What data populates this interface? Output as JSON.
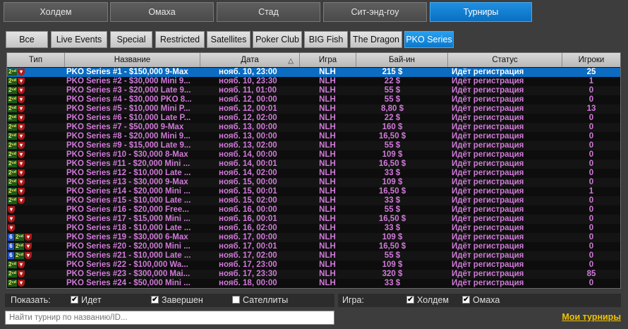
{
  "main_tabs": [
    "Холдем",
    "Омаха",
    "Стад",
    "Сит-энд-гоу",
    "Турниры"
  ],
  "main_tab_active": "Турниры",
  "sub_tabs": [
    "Все",
    "Live Events",
    "Special",
    "Restricted",
    "Satellites",
    "Poker Club",
    "BIG Fish",
    "The Dragon",
    "PKO Series"
  ],
  "sub_tab_active": "PKO Series",
  "columns": {
    "type": "Тип",
    "name": "Название",
    "date": "Дата",
    "game": "Игра",
    "buyin": "Бай-ин",
    "status": "Статус",
    "players": "Игроки"
  },
  "sort_indicator": "△",
  "rows": [
    {
      "icons": [
        "2nd",
        "shield"
      ],
      "name": "PKO Series #1 - $150,000 9-Max",
      "date": "нояб. 10, 23:00",
      "game": "NLH",
      "buyin": "215 $",
      "status": "Идёт регистрация",
      "players": "25",
      "selected": true
    },
    {
      "icons": [
        "2nd",
        "shield"
      ],
      "name": "PKO Series #2 - $30,000 Mini 9...",
      "date": "нояб. 10, 23:30",
      "game": "NLH",
      "buyin": "22 $",
      "status": "Идёт регистрация",
      "players": "1"
    },
    {
      "icons": [
        "2nd",
        "shield"
      ],
      "name": "PKO Series #3 - $20,000 Late 9...",
      "date": "нояб. 11, 01:00",
      "game": "NLH",
      "buyin": "55 $",
      "status": "Идёт регистрация",
      "players": "0"
    },
    {
      "icons": [
        "2nd",
        "shield"
      ],
      "name": "PKO Series #4 - $30,000 PKO 8...",
      "date": "нояб. 12, 00:00",
      "game": "NLH",
      "buyin": "55 $",
      "status": "Идёт регистрация",
      "players": "0"
    },
    {
      "icons": [
        "2nd",
        "shield"
      ],
      "name": "PKO Series #5 - $10,000 Mini P...",
      "date": "нояб. 12, 00:01",
      "game": "NLH",
      "buyin": "8,80 $",
      "status": "Идёт регистрация",
      "players": "13"
    },
    {
      "icons": [
        "2nd",
        "shield"
      ],
      "name": "PKO Series #6 - $10,000 Late P...",
      "date": "нояб. 12, 02:00",
      "game": "NLH",
      "buyin": "22 $",
      "status": "Идёт регистрация",
      "players": "0"
    },
    {
      "icons": [
        "2nd",
        "shield"
      ],
      "name": "PKO Series #7 - $50,000 9-Max",
      "date": "нояб. 13, 00:00",
      "game": "NLH",
      "buyin": "160 $",
      "status": "Идёт регистрация",
      "players": "0"
    },
    {
      "icons": [
        "2nd",
        "shield"
      ],
      "name": "PKO Series #8 - $20,000 Mini 9...",
      "date": "нояб. 13, 00:00",
      "game": "NLH",
      "buyin": "16,50 $",
      "status": "Идёт регистрация",
      "players": "0"
    },
    {
      "icons": [
        "2nd",
        "shield"
      ],
      "name": "PKO Series #9 - $15,000 Late 9...",
      "date": "нояб. 13, 02:00",
      "game": "NLH",
      "buyin": "55 $",
      "status": "Идёт регистрация",
      "players": "0"
    },
    {
      "icons": [
        "2nd",
        "shield"
      ],
      "name": "PKO Series #10 - $30,000 8-Max",
      "date": "нояб. 14, 00:00",
      "game": "NLH",
      "buyin": "109 $",
      "status": "Идёт регистрация",
      "players": "0"
    },
    {
      "icons": [
        "2nd",
        "shield"
      ],
      "name": "PKO Series #11 - $20,000 Mini ...",
      "date": "нояб. 14, 00:01",
      "game": "NLH",
      "buyin": "16,50 $",
      "status": "Идёт регистрация",
      "players": "0"
    },
    {
      "icons": [
        "2nd",
        "shield"
      ],
      "name": "PKO Series #12 - $10,000 Late ...",
      "date": "нояб. 14, 02:00",
      "game": "NLH",
      "buyin": "33 $",
      "status": "Идёт регистрация",
      "players": "0"
    },
    {
      "icons": [
        "2nd",
        "shield"
      ],
      "name": "PKO Series #13 - $30,000 9-Max",
      "date": "нояб. 15, 00:00",
      "game": "NLH",
      "buyin": "109 $",
      "status": "Идёт регистрация",
      "players": "0"
    },
    {
      "icons": [
        "2nd",
        "shield"
      ],
      "name": "PKO Series #14 - $20,000 Mini ...",
      "date": "нояб. 15, 00:01",
      "game": "NLH",
      "buyin": "16,50 $",
      "status": "Идёт регистрация",
      "players": "1"
    },
    {
      "icons": [
        "2nd",
        "shield"
      ],
      "name": "PKO Series #15 - $10,000 Late ...",
      "date": "нояб. 15, 02:00",
      "game": "NLH",
      "buyin": "33 $",
      "status": "Идёт регистрация",
      "players": "0"
    },
    {
      "icons": [
        "shield"
      ],
      "name": "PKO Series #16 - $20,000 Free...",
      "date": "нояб. 16, 00:00",
      "game": "NLH",
      "buyin": "55 $",
      "status": "Идёт регистрация",
      "players": "0"
    },
    {
      "icons": [
        "shield"
      ],
      "name": "PKO Series #17 - $15,000 Mini ...",
      "date": "нояб. 16, 00:01",
      "game": "NLH",
      "buyin": "16,50 $",
      "status": "Идёт регистрация",
      "players": "0"
    },
    {
      "icons": [
        "shield"
      ],
      "name": "PKO Series #18 - $10,000 Late ...",
      "date": "нояб. 16, 02:00",
      "game": "NLH",
      "buyin": "33 $",
      "status": "Идёт регистрация",
      "players": "0"
    },
    {
      "icons": [
        "6",
        "2nd",
        "shield"
      ],
      "name": "PKO Series #19 - $30,000 6-Max",
      "date": "нояб. 17, 00:00",
      "game": "NLH",
      "buyin": "109 $",
      "status": "Идёт регистрация",
      "players": "0"
    },
    {
      "icons": [
        "6",
        "2nd",
        "shield"
      ],
      "name": "PKO Series #20 - $20,000 Mini ...",
      "date": "нояб. 17, 00:01",
      "game": "NLH",
      "buyin": "16,50 $",
      "status": "Идёт регистрация",
      "players": "0"
    },
    {
      "icons": [
        "6",
        "2nd",
        "shield"
      ],
      "name": "PKO Series #21 - $10,000 Late ...",
      "date": "нояб. 17, 02:00",
      "game": "NLH",
      "buyin": "55 $",
      "status": "Идёт регистрация",
      "players": "0"
    },
    {
      "icons": [
        "2nd",
        "shield"
      ],
      "name": "PKO Series #22 - $100,000 Wa...",
      "date": "нояб. 17, 23:00",
      "game": "NLH",
      "buyin": "109 $",
      "status": "Идёт регистрация",
      "players": "0"
    },
    {
      "icons": [
        "2nd",
        "shield"
      ],
      "name": "PKO Series #23 - $300,000 Mai...",
      "date": "нояб. 17, 23:30",
      "game": "NLH",
      "buyin": "320 $",
      "status": "Идёт регистрация",
      "players": "85"
    },
    {
      "icons": [
        "2nd",
        "shield"
      ],
      "name": "PKO Series #24 - $50,000 Mini ...",
      "date": "нояб. 18, 00:00",
      "game": "NLH",
      "buyin": "33 $",
      "status": "Идёт регистрация",
      "players": "0"
    }
  ],
  "filters": {
    "show_label": "Показать:",
    "running_label": "Идет",
    "running_checked": true,
    "finished_label": "Завершен",
    "finished_checked": true,
    "satellites_label": "Сателлиты",
    "satellites_checked": false,
    "game_label": "Игра:",
    "holdem_label": "Холдем",
    "holdem_checked": true,
    "omaha_label": "Омаха",
    "omaha_checked": true
  },
  "search": {
    "placeholder": "Найти турнир по названию/ID..."
  },
  "my_tournaments_label": "Мои турниры",
  "colors": {
    "accent": "#0b78cc",
    "row_text": "#d07ad8",
    "link": "#f0c300"
  }
}
